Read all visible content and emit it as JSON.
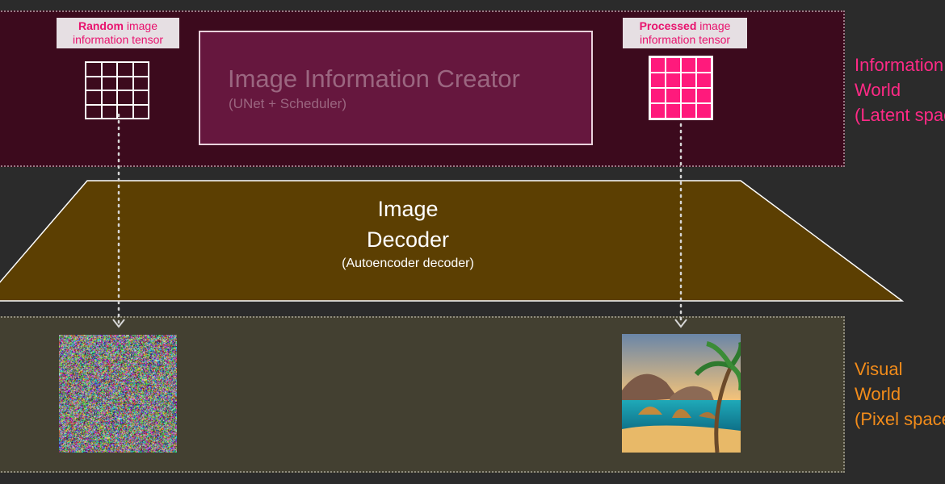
{
  "latent": {
    "random_label_bold": "Random",
    "random_label_rest": " image",
    "random_label_line2": "information tensor",
    "processed_label_bold": "Processed",
    "processed_label_rest": " image",
    "processed_label_line2": "information tensor",
    "creator_title": "Image Information Creator",
    "creator_subtitle": "(UNet + Scheduler)",
    "world_label_1": "Information",
    "world_label_2": "World",
    "world_label_3": "(Latent space)"
  },
  "decoder": {
    "title_line1": "Image",
    "title_line2": "Decoder",
    "subtitle": "(Autoencoder decoder)"
  },
  "visual": {
    "world_label_1": "Visual",
    "world_label_2": "World",
    "world_label_3": "(Pixel space)"
  },
  "colors": {
    "latent_accent": "#ff2a86",
    "visual_accent": "#f38c1a",
    "decoder_fill": "#5c3f02"
  }
}
